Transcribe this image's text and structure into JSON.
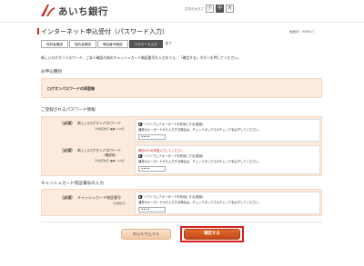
{
  "brand": {
    "name": "あいち銀行",
    "color": "#c52b1c"
  },
  "font_size": {
    "label": "文字の大きさ",
    "options": [
      "小",
      "中",
      "大"
    ],
    "selected": "中"
  },
  "screen_id": "画面ID：BIM017",
  "page": {
    "title": "インターネット申込受付（パスワード入力）",
    "steps": [
      "契約者確認",
      "契約者確認",
      "電話番号確認",
      "パスワード入力",
      "完了"
    ],
    "current_step": 3,
    "intro": "新しいログオンパスワード、ご本人確認の為のキャッシュカード暗証番号を入力のうえ、「確定する」ボタンを押してください。"
  },
  "application_type": {
    "section_title": "お申込種別",
    "value": "ログオンパスワードの再登録"
  },
  "password_section": {
    "title": "ご登録されるパスワード情報",
    "new_password": {
      "required": "［必須］",
      "label": "新しいログオンパスワード",
      "sub": "（半角英数字 ●●〜12桁）",
      "check_label": "ソフトウェアキーボードを有効にする(推奨)",
      "note": "通常のキーボードから入力する場合は、チェックボックスのチェックをはずしてください。",
      "value": "••••"
    },
    "confirm_password": {
      "required": "［必須］",
      "label": "新しいログオンパスワード",
      "label2": "（確認用）",
      "sub": "（半角英数字 ●●〜12桁）",
      "warn": "確認のため再度入力してください",
      "check_label": "ソフトウェアキーボードを有効にする(推奨)",
      "note": "通常のキーボードから入力する場合は、チェックボックスのチェックをはずしてください。",
      "value": "••••"
    }
  },
  "card_section": {
    "title": "キャッシュカード暗証番号の入力",
    "pin": {
      "required": "［必須］",
      "label": "キャッシュカード暗証番号",
      "sub": "（半角数字）",
      "check_label": "ソフトウェアキーボードを有効にする(推奨)",
      "note": "通常のキーボードから入力する場合は、チェックボックスのチェックをはずしてください。",
      "value": "••••"
    }
  },
  "buttons": {
    "cancel": "申込を中止する",
    "confirm": "確定する"
  }
}
